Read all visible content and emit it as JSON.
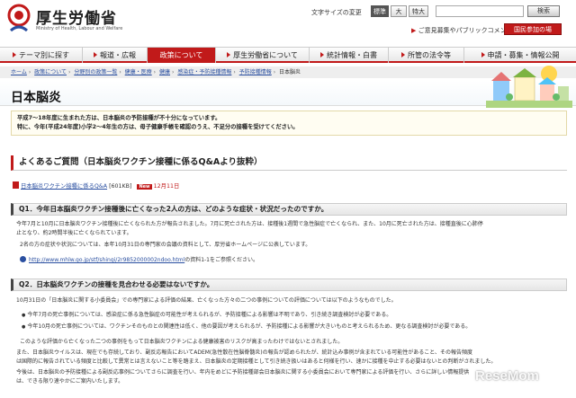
{
  "header": {
    "site_title": "厚生労働省",
    "site_subtitle": "Ministry of Health, Labour and Welfare",
    "font_size_label": "文字サイズの変更",
    "font_sizes": [
      "標準",
      "大",
      "特大"
    ],
    "search_button": "検索",
    "opinion_link": "ご意見募集やパブリックコメントはこちら",
    "citizen_button": "国民参加の場"
  },
  "nav": {
    "items": [
      "テーマ別に探す",
      "報道・広報",
      "政策について",
      "厚生労働省について",
      "統計情報・白書",
      "所管の法令等",
      "申請・募集・情報公開"
    ],
    "accent": "#c11a1a"
  },
  "breadcrumb": {
    "items": [
      "ホーム",
      "政策について",
      "分野別の政策一覧",
      "健康・医療",
      "健康",
      "感染症・予防接種情報",
      "予防接種情報"
    ],
    "current": "日本脳炎"
  },
  "page": {
    "title": "日本脳炎",
    "notice_line1": "平成7〜18年度に生まれた方は、日本脳炎の予防接種が不十分になっています。",
    "notice_line2": "特に、今年(平成24年度)小学2〜4年生の方は、母子健康手帳を確認のうえ、不足分の接種を受けてください。",
    "section_title": "よくあるご質問（日本脳炎ワクチン接種に係るQ&Aより抜粋）",
    "pdf_link": "日本脳炎ワクチン接種に係るQ&A",
    "pdf_size": "[601KB]",
    "new_badge": "New",
    "pdf_date": "12月11日",
    "q1": "Q1．今年日本脳炎ワクチン接種後に亡くなった2人の方は、どのような症状・状況だったのですか。",
    "q1_text1": "今年7月と10月に日本脳炎ワクチン接種後に亡くなられた方が報告されました。7月に死亡された方は、接種後1週間で急性脳症で亡くなられ、また、10月に死亡された方は、接種直後に心肺停",
    "q1_text2": "止となり、約2時間半後に亡くなられています。",
    "q1_text3": "2名の方の症状や状況については、本年10月31日の専門家の会議の資料として、厚労省ホームページに公表しています。",
    "q1_url": "http://www.mhlw.go.jp/stf/shingi/2r9852000002ndoo.html",
    "q1_url_note": "の資料1-1をご参照ください。",
    "q2": "Q2．日本脳炎ワクチンの接種を見合わせる必要はないですか。",
    "q2_text1": "10月31日の「日本脳炎に関する小委員会」での専門家による評価の結果、亡くなった方々の二つの事例についての評価については以下のようなものでした。",
    "q2_bullet1": "今年7月の死亡事例については、感染症に係る急性脳症の可能性が考えられるが、予防接種による影響は不明であり、引き続き調査検討が必要である。",
    "q2_bullet2": "今年10月の死亡事例については、ワクチンそのものとの関連性は低く、他の要因が考えられるが、予防接種による影響が大きいものと考えられるため、更なる調査検討が必要である。",
    "q2_text2": "このような評価から亡くなった二つの事例をもって日本脳炎ワクチンによる健康被害のリスクが高まったわけではないとされました。",
    "q2_text3": "また、日本脳炎ウイルスは、現在でも存続しており、副反応報告においてADEM(急性散在性脳脊髄炎)の報告が認められたが、統計込み事例が含まれている可能性があること、その報告頻度",
    "q2_text4": "は国際的に報告されている頻度と比較して異常とは言えないこと等を踏まえ、日本脳炎の定期接種として引き続き扱いはあると何様を行い、速かに接種を中止する必要はないとの判断がされました。",
    "q2_text5": "今後は、日本脳炎の予防接種による副反応事例についてさらに調査を行い、年内をめどに予防接種部会日本脳炎に関する小委員会において専門家による評価を行い、さらに詳しい情報提供",
    "q2_text6": "は、できる限り速やかにご案内いたします。"
  },
  "watermark": "ReseMom"
}
